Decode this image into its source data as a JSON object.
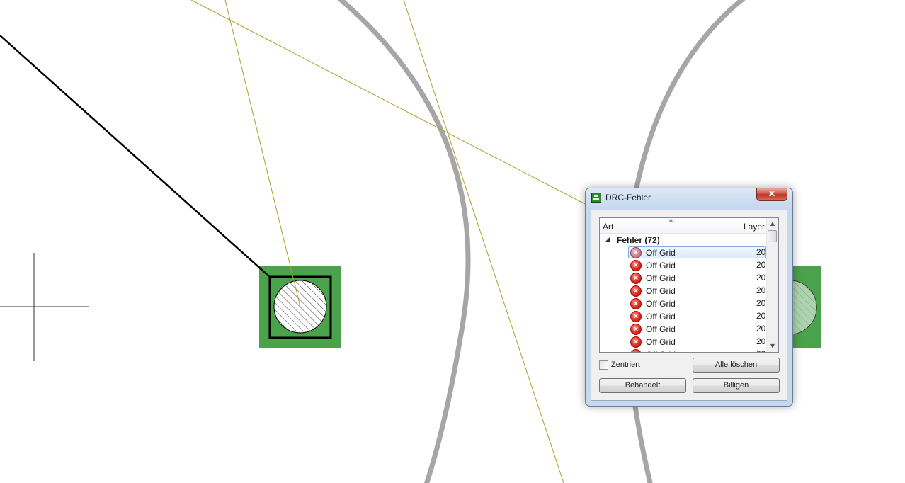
{
  "canvas": {
    "pad_color": "#4aa24a",
    "trace_color": "#000000",
    "ratsnest_color": "#a9a02a",
    "circle_color": "#a6a6a6"
  },
  "dialog": {
    "title": "DRC-Fehler",
    "icon": "board-icon",
    "close_label": "x",
    "list": {
      "col_type": "Art",
      "col_layer": "Layer",
      "group_label": "Fehler (72)",
      "rows": [
        {
          "label": "Off Grid",
          "layer": "20",
          "icon": "error-icon",
          "selected": true
        },
        {
          "label": "Off Grid",
          "layer": "20",
          "icon": "error-icon"
        },
        {
          "label": "Off Grid",
          "layer": "20",
          "icon": "error-icon"
        },
        {
          "label": "Off Grid",
          "layer": "20",
          "icon": "error-icon"
        },
        {
          "label": "Off Grid",
          "layer": "20",
          "icon": "error-icon"
        },
        {
          "label": "Off Grid",
          "layer": "20",
          "icon": "error-icon"
        },
        {
          "label": "Off Grid",
          "layer": "20",
          "icon": "error-icon"
        },
        {
          "label": "Off Grid",
          "layer": "20",
          "icon": "error-icon"
        },
        {
          "label": "Off Grid",
          "layer": "20",
          "icon": "error-icon"
        }
      ]
    },
    "checkbox_label": "Zentriert",
    "buttons": {
      "clear_all": "Alle löschen",
      "processed": "Behandelt",
      "approve": "Billigen"
    }
  }
}
